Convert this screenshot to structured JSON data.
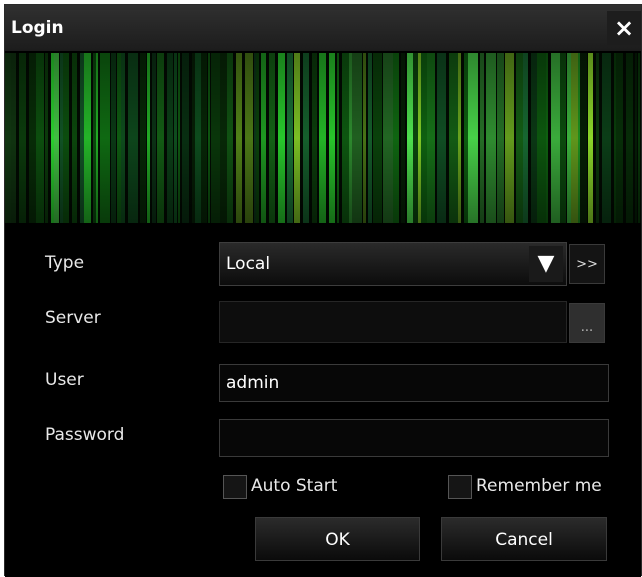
{
  "window": {
    "title": "Login",
    "close_icon": "×"
  },
  "form": {
    "type": {
      "label": "Type",
      "value": "Local",
      "dropdown_icon": "▼",
      "expand_label": ">>"
    },
    "server": {
      "label": "Server",
      "value": "",
      "browse_label": "..."
    },
    "user": {
      "label": "User",
      "value": "admin"
    },
    "password": {
      "label": "Password",
      "value": ""
    },
    "auto_start": {
      "label": "Auto Start",
      "checked": false
    },
    "remember_me": {
      "label": "Remember me",
      "checked": false
    },
    "ok_label": "OK",
    "cancel_label": "Cancel"
  },
  "colors": {
    "accent": "#19c21f",
    "background": "#000000"
  }
}
